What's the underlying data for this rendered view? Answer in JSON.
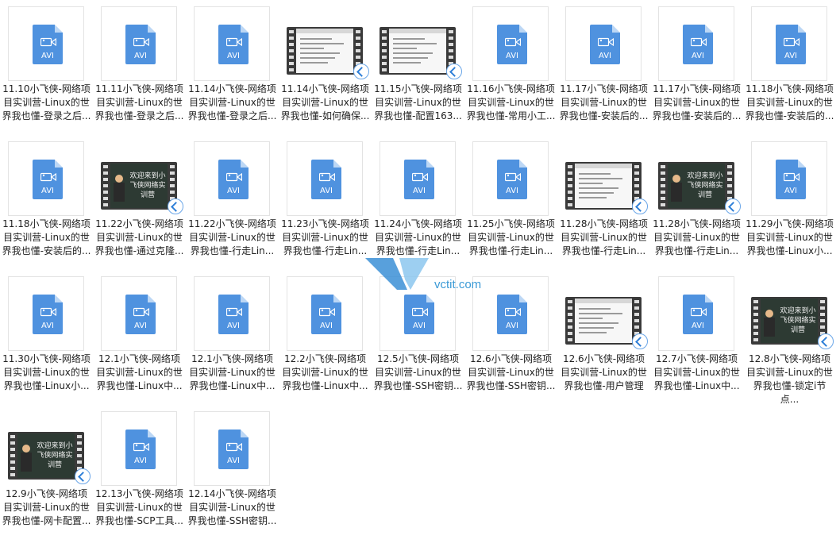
{
  "files": [
    {
      "name": "11.10小飞侠-网络项目实训营-Linux的世界我也懂-登录之后...",
      "thumb": "avi"
    },
    {
      "name": "11.11小飞侠-网络项目实训营-Linux的世界我也懂-登录之后...",
      "thumb": "avi"
    },
    {
      "name": "11.14小飞侠-网络项目实训营-Linux的世界我也懂-登录之后...",
      "thumb": "avi"
    },
    {
      "name": "11.14小飞侠-网络项目实训营-Linux的世界我也懂-如何确保...",
      "thumb": "screen"
    },
    {
      "name": "11.15小飞侠-网络项目实训营-Linux的世界我也懂-配置163...",
      "thumb": "screen"
    },
    {
      "name": "11.16小飞侠-网络项目实训营-Linux的世界我也懂-常用小工...",
      "thumb": "avi"
    },
    {
      "name": "11.17小飞侠-网络项目实训营-Linux的世界我也懂-安装后的...",
      "thumb": "avi"
    },
    {
      "name": "11.17小飞侠-网络项目实训营-Linux的世界我也懂-安装后的...",
      "thumb": "avi"
    },
    {
      "name": "11.18小飞侠-网络项目实训营-Linux的世界我也懂-安装后的...",
      "thumb": "avi"
    },
    {
      "name": "11.18小飞侠-网络项目实训营-Linux的世界我也懂-安装后的...",
      "thumb": "avi"
    },
    {
      "name": "11.22小飞侠-网络项目实训营-Linux的世界我也懂-通过克隆...",
      "thumb": "board"
    },
    {
      "name": "11.22小飞侠-网络项目实训营-Linux的世界我也懂-行走Lin...",
      "thumb": "avi"
    },
    {
      "name": "11.23小飞侠-网络项目实训营-Linux的世界我也懂-行走Lin...",
      "thumb": "avi"
    },
    {
      "name": "11.24小飞侠-网络项目实训营-Linux的世界我也懂-行走Lin...",
      "thumb": "avi"
    },
    {
      "name": "11.25小飞侠-网络项目实训营-Linux的世界我也懂-行走Lin...",
      "thumb": "avi"
    },
    {
      "name": "11.28小飞侠-网络项目实训营-Linux的世界我也懂-行走Lin...",
      "thumb": "screen"
    },
    {
      "name": "11.28小飞侠-网络项目实训营-Linux的世界我也懂-行走Lin...",
      "thumb": "board"
    },
    {
      "name": "11.29小飞侠-网络项目实训营-Linux的世界我也懂-Linux小...",
      "thumb": "avi"
    },
    {
      "name": "11.30小飞侠-网络项目实训营-Linux的世界我也懂-Linux小...",
      "thumb": "avi"
    },
    {
      "name": "12.1小飞侠-网络项目实训营-Linux的世界我也懂-Linux中...",
      "thumb": "avi"
    },
    {
      "name": "12.1小飞侠-网络项目实训营-Linux的世界我也懂-Linux中...",
      "thumb": "avi"
    },
    {
      "name": "12.2小飞侠-网络项目实训营-Linux的世界我也懂-Linux中...",
      "thumb": "avi"
    },
    {
      "name": "12.5小飞侠-网络项目实训营-Linux的世界我也懂-SSH密钥...",
      "thumb": "avi"
    },
    {
      "name": "12.6小飞侠-网络项目实训营-Linux的世界我也懂-SSH密钥...",
      "thumb": "avi"
    },
    {
      "name": "12.6小飞侠-网络项目实训营-Linux的世界我也懂-用户管理",
      "thumb": "screen"
    },
    {
      "name": "12.7小飞侠-网络项目实训营-Linux的世界我也懂-Linux中...",
      "thumb": "avi"
    },
    {
      "name": "12.8小飞侠-网络项目实训营-Linux的世界我也懂-锁定i节点...",
      "thumb": "board"
    },
    {
      "name": "12.9小飞侠-网络项目实训营-Linux的世界我也懂-网卡配置...",
      "thumb": "board"
    },
    {
      "name": "12.13小飞侠-网络项目实训营-Linux的世界我也懂-SCP工具...",
      "thumb": "avi"
    },
    {
      "name": "12.14小飞侠-网络项目实训营-Linux的世界我也懂-SSH密钥...",
      "thumb": "avi"
    }
  ],
  "file_type_label": "AVI",
  "board_text": "欢迎来到小飞侠网络实训营",
  "watermark": "vctit.com"
}
